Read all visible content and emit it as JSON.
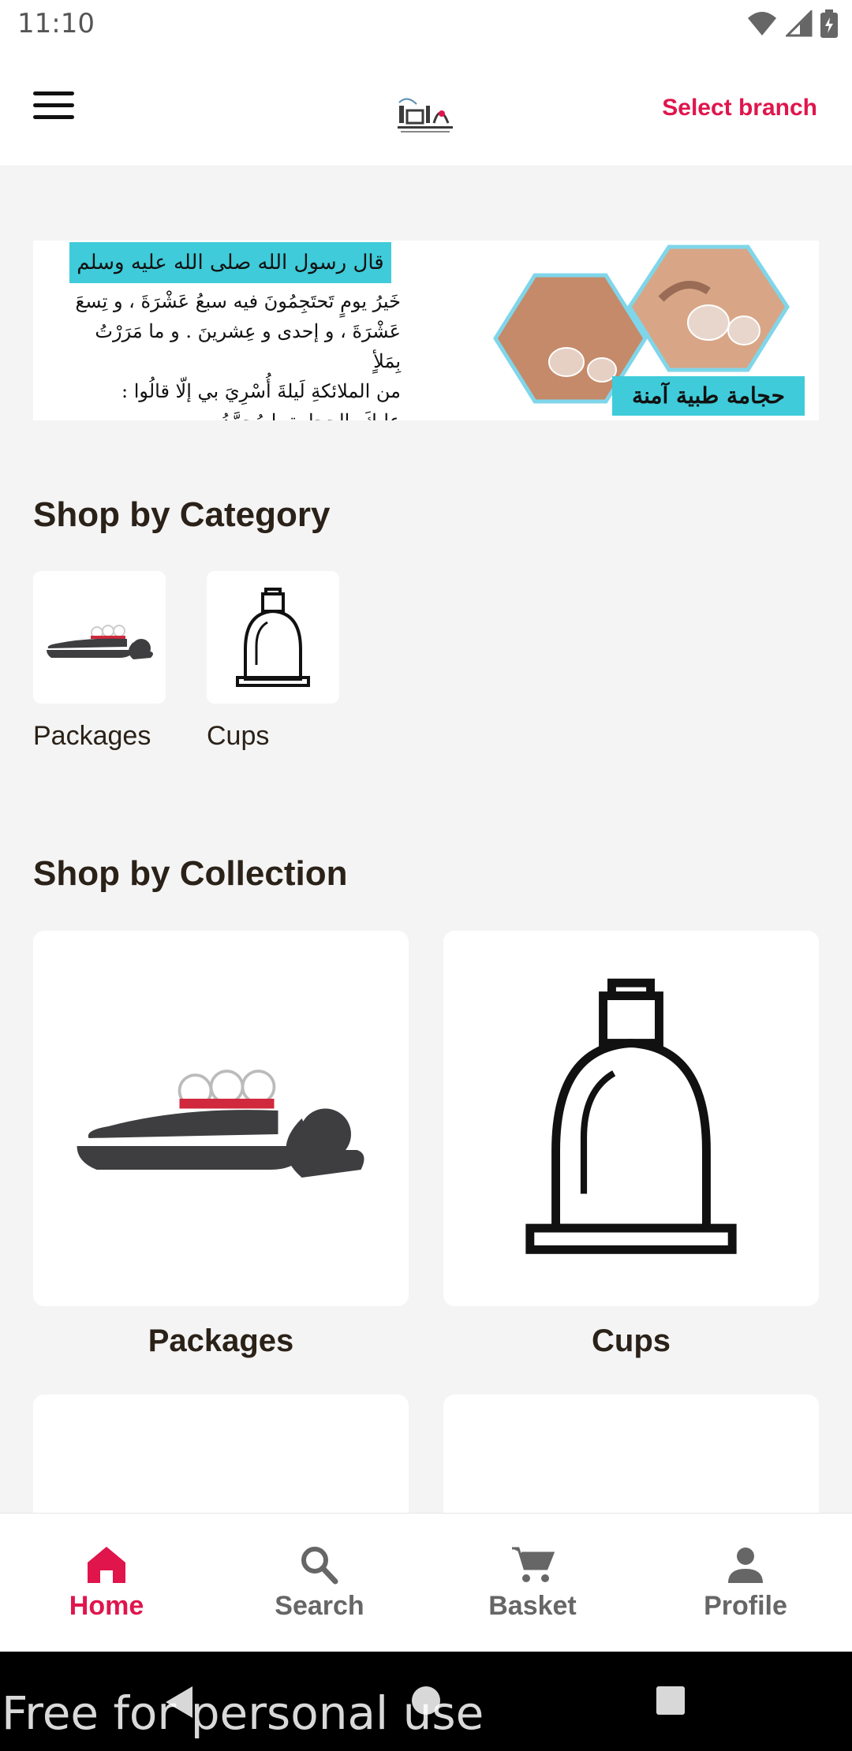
{
  "status_bar": {
    "time": "11:10",
    "icons": [
      "wifi-icon",
      "signal-icon",
      "battery-icon"
    ]
  },
  "app_bar": {
    "menu_icon": "hamburger-menu-icon",
    "logo": "brand-logo",
    "branch_label": "Select branch"
  },
  "banner": {
    "header": "قال رسول الله صلى الله عليه وسلم",
    "lines": [
      "خَيرُ يومٍ تَحتَجِمُونَ فيه سبعُ عَشْرَةَ ، و تِسعَ",
      "عَشْرَةَ ، و إحدى و عِشرينَ . و ما مَرَرْتُ بِمَلأٍ",
      "من الملائكةِ لَيلةَ أُسْرِيَ بي إلّا قالُوا :",
      "عليكَ بالحِجامةِ يا مُحمَّدُ."
    ],
    "tag": "حجامة طبية آمنة"
  },
  "categories": {
    "title": "Shop by Category",
    "items": [
      {
        "label": "Packages",
        "icon": "cupping-packages-icon"
      },
      {
        "label": "Cups",
        "icon": "cupping-cup-icon"
      }
    ]
  },
  "collections": {
    "title": "Shop by Collection",
    "items": [
      {
        "label": "Packages",
        "icon": "cupping-packages-icon"
      },
      {
        "label": "Cups",
        "icon": "cupping-cup-icon"
      }
    ]
  },
  "bottom_nav": {
    "items": [
      {
        "label": "Home",
        "icon": "home-icon",
        "active": true
      },
      {
        "label": "Search",
        "icon": "search-icon",
        "active": false
      },
      {
        "label": "Basket",
        "icon": "cart-icon",
        "active": false
      },
      {
        "label": "Profile",
        "icon": "person-icon",
        "active": false
      }
    ]
  },
  "watermark": "Free for personal use",
  "colors": {
    "accent": "#e0154c",
    "banner_cyan": "#3fcbd9",
    "text_dark": "#2a2118"
  }
}
